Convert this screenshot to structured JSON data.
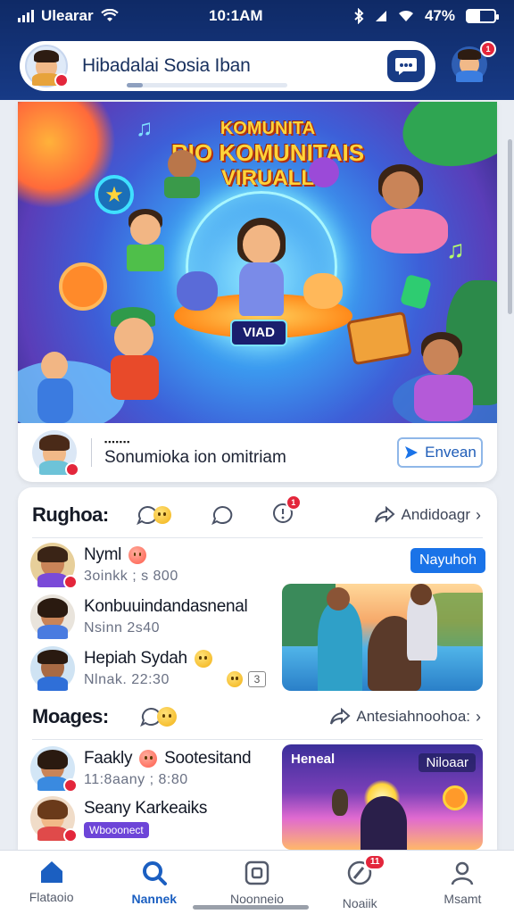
{
  "status_bar": {
    "carrier": "Ulearar",
    "time": "10:1AM",
    "battery": "47%",
    "battery_level": 0.47
  },
  "header": {
    "title": "Hibadalai Sosia Iban",
    "chat_icon": "chat-bubble-icon",
    "notification_badge": "1",
    "scroll_progress": 0.1
  },
  "hero": {
    "title_line1": "KOMUNITA",
    "title_line2": "RIO KOMUNITAIS",
    "title_line3": "VIRUALL",
    "button_label": "VIAD"
  },
  "composer": {
    "small_label": "▪▪▪▪▪▪▪",
    "prompt": "Sonumioka ion omitriam",
    "share_label": "Envean",
    "colors": {
      "accent": "#1a73e8",
      "brand": "#173a86",
      "alert": "#e3263b"
    }
  },
  "sections": {
    "first": {
      "title": "Rughoa:",
      "notification_count": "1",
      "link_label": "Andidoagr",
      "rows": [
        {
          "name": "Nyml",
          "sub": "3oinkk ; s 800",
          "action": "Nayuhoh"
        },
        {
          "name": "Konbuuindandasnenal",
          "sub": "Nsinn 2s40"
        },
        {
          "name": "Hepiah Sydah",
          "sub": "Nlnak. 22:30",
          "reaction_count": "3"
        }
      ]
    },
    "second": {
      "title": "Moages:",
      "link_label": "Antesiahnoohoa:",
      "rows": [
        {
          "name": "Faakly",
          "name_suffix": "Sootesitand",
          "sub": "11:8aany ; 8:80"
        },
        {
          "name": "Seany Karkeaiks",
          "badge": "Wbooonect"
        }
      ],
      "media_left": "Heneal",
      "media_right": "Niloaar"
    }
  },
  "bottom_nav": [
    {
      "label": "Flataoio",
      "icon": "home-icon"
    },
    {
      "label": "Nannek",
      "icon": "search-icon",
      "active": true
    },
    {
      "label": "Noonneio",
      "icon": "square-icon"
    },
    {
      "label": "Noaiik",
      "icon": "edit-icon",
      "badge": "11"
    },
    {
      "label": "Msamt",
      "icon": "profile-icon"
    }
  ]
}
